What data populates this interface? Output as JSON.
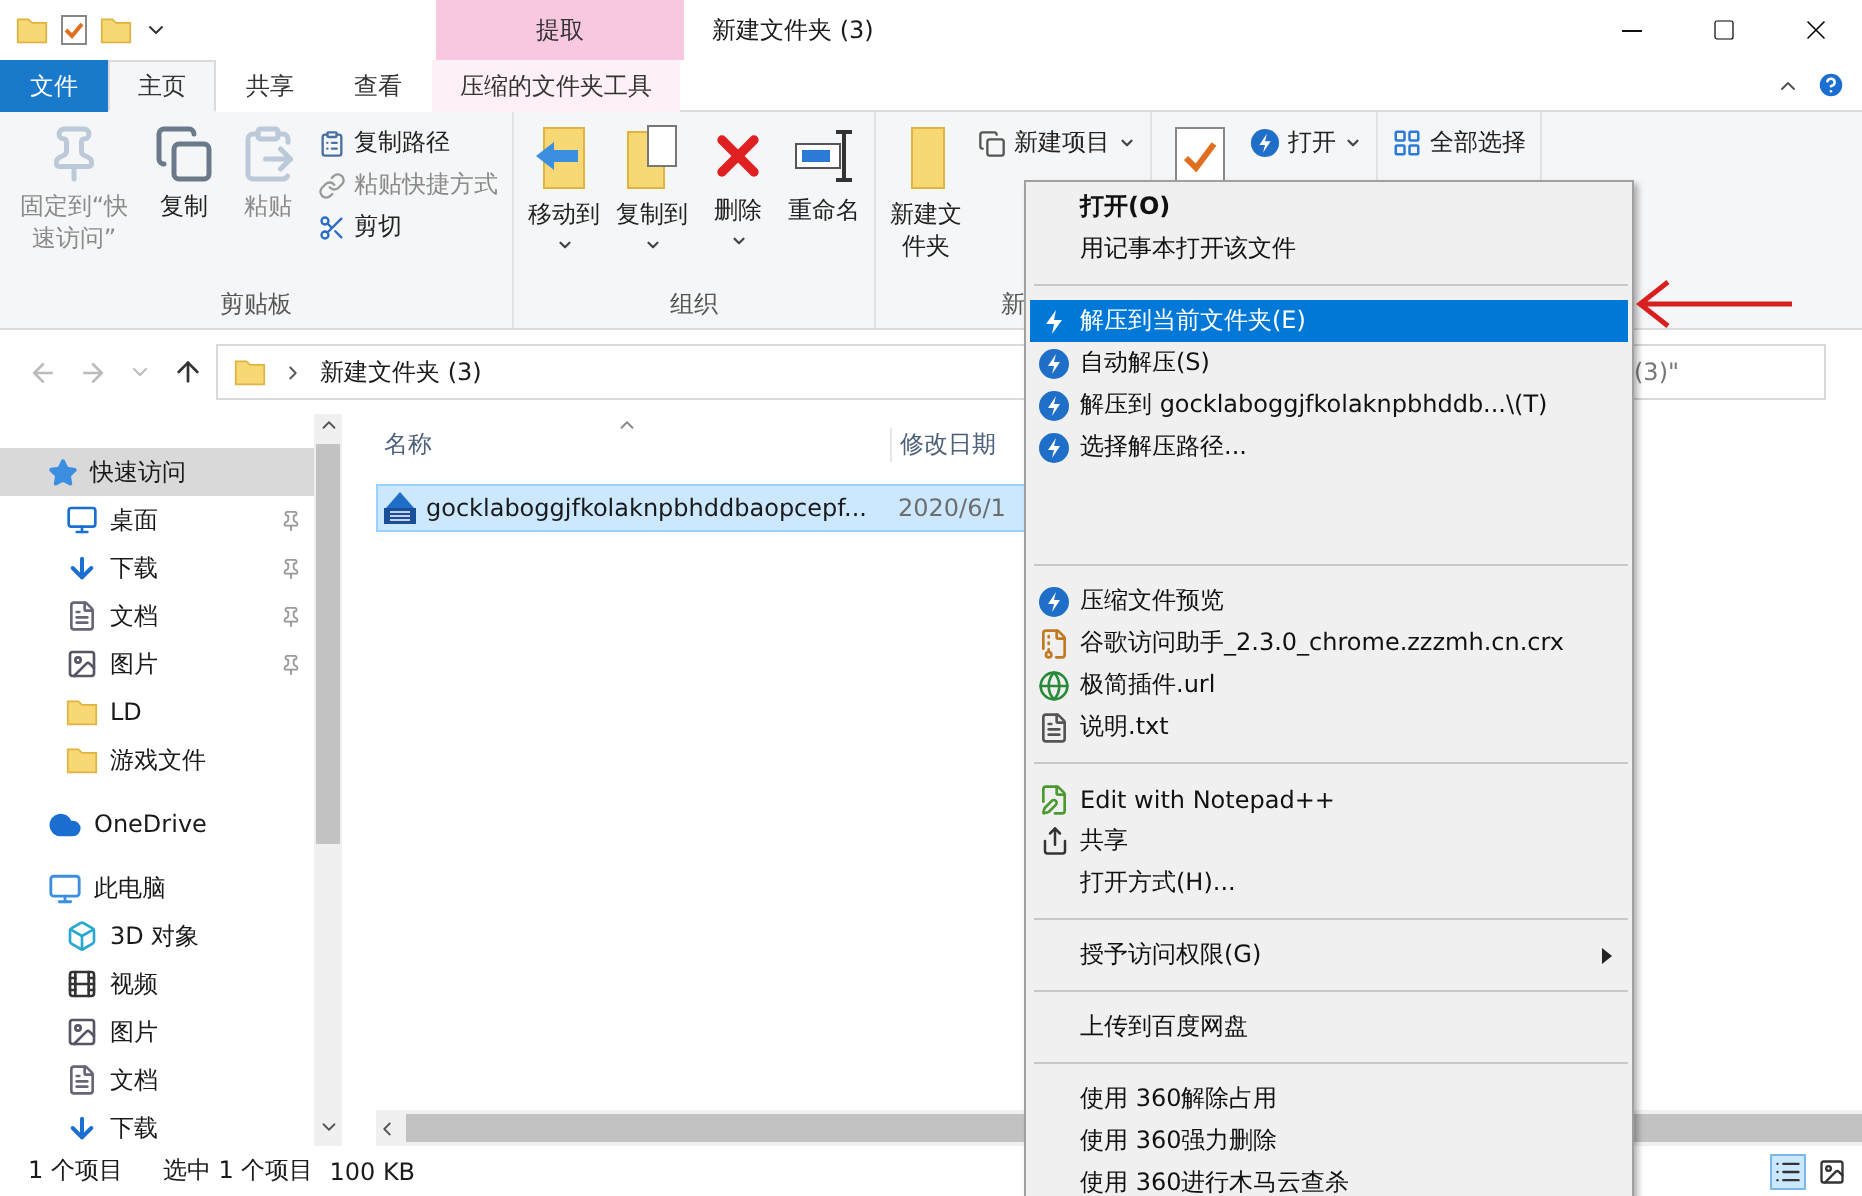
{
  "title_bar": {
    "title": "新建文件夹 (3)",
    "context_tab": "提取"
  },
  "ribbon_tabs": [
    {
      "label": "文件",
      "kind": "file",
      "selected": false
    },
    {
      "label": "主页",
      "kind": "tab",
      "selected": true
    },
    {
      "label": "共享",
      "kind": "tab",
      "selected": false
    },
    {
      "label": "查看",
      "kind": "tab",
      "selected": false
    },
    {
      "label": "压缩的文件夹工具",
      "kind": "context",
      "selected": false
    }
  ],
  "ribbon_groups": [
    {
      "label": "剪贴板",
      "items": [
        {
          "kind": "large",
          "label": "固定到“快速访问”",
          "disabled": true,
          "dropdown": false
        },
        {
          "kind": "large",
          "label": "复制",
          "disabled": false,
          "dropdown": false
        },
        {
          "kind": "large",
          "label": "粘贴",
          "disabled": true,
          "dropdown": false
        },
        {
          "kind": "small",
          "label": "复制路径",
          "disabled": false,
          "dropdown": false
        },
        {
          "kind": "small",
          "label": "粘贴快捷方式",
          "disabled": true,
          "dropdown": false
        },
        {
          "kind": "small",
          "label": "剪切",
          "disabled": false,
          "dropdown": false
        }
      ]
    },
    {
      "label": "组织",
      "items": [
        {
          "kind": "large",
          "label": "移动到",
          "disabled": false,
          "dropdown": true
        },
        {
          "kind": "large",
          "label": "复制到",
          "disabled": false,
          "dropdown": true
        },
        {
          "kind": "large",
          "label": "删除",
          "disabled": false,
          "dropdown": true
        },
        {
          "kind": "large",
          "label": "重命名",
          "disabled": false,
          "dropdown": false
        }
      ]
    },
    {
      "label": "新",
      "items": [
        {
          "kind": "large",
          "label": "新建文件夹",
          "disabled": false,
          "dropdown": false
        },
        {
          "kind": "small",
          "label": "新建项目",
          "disabled": false,
          "dropdown": true
        }
      ]
    },
    {
      "items": [
        {
          "kind": "large",
          "disabled": false
        },
        {
          "kind": "small",
          "label": "打开",
          "disabled": false,
          "dropdown": true
        }
      ]
    },
    {
      "items": [
        {
          "kind": "small",
          "label": "全部选择",
          "disabled": false,
          "dropdown": false
        }
      ]
    }
  ],
  "address": {
    "path": "新建文件夹 (3)"
  },
  "search": {
    "placeholder": "(3)\""
  },
  "navigation": [
    {
      "label": "快速访问",
      "selected": true,
      "pinned": false,
      "children": [
        {
          "label": "桌面",
          "selected": false,
          "pinned": true
        },
        {
          "label": "下载",
          "selected": false,
          "pinned": true
        },
        {
          "label": "文档",
          "selected": false,
          "pinned": true
        },
        {
          "label": "图片",
          "selected": false,
          "pinned": true
        },
        {
          "label": "LD",
          "selected": false,
          "pinned": false
        },
        {
          "label": "游戏文件",
          "selected": false,
          "pinned": false
        }
      ]
    },
    {
      "label": "OneDrive",
      "selected": false,
      "pinned": false
    },
    {
      "label": "此电脑",
      "selected": false,
      "pinned": false,
      "children": [
        {
          "label": "3D 对象",
          "selected": false,
          "pinned": false
        },
        {
          "label": "视频",
          "selected": false,
          "pinned": false
        },
        {
          "label": "图片",
          "selected": false,
          "pinned": false
        },
        {
          "label": "文档",
          "selected": false,
          "pinned": false
        },
        {
          "label": "下载",
          "selected": false,
          "pinned": false
        }
      ]
    }
  ],
  "file_list": {
    "columns": [
      "名称",
      "修改日期"
    ],
    "rows": [
      {
        "name": "gocklaboggjfkolaknpbhddbaopcepf...",
        "date": "2020/6/1",
        "selected": true
      }
    ]
  },
  "status_bar": {
    "count": "1 个项目",
    "selection": "选中 1 个项目",
    "size": "100 KB",
    "views": [
      {
        "kind": "details",
        "selected": true
      },
      {
        "kind": "thumbnails",
        "selected": false
      }
    ]
  },
  "context_menu": {
    "sections": [
      [
        {
          "kind": "plain",
          "label": "打开(O)",
          "default": true,
          "selected": false,
          "submenu": false
        },
        {
          "kind": "plain",
          "label": "用记事本打开该文件",
          "default": false,
          "selected": false,
          "submenu": false
        }
      ],
      [
        {
          "kind": "extract",
          "label": "解压到当前文件夹(E)",
          "default": false,
          "selected": true,
          "submenu": false
        },
        {
          "kind": "extract",
          "label": "自动解压(S)",
          "default": false,
          "selected": false,
          "submenu": false
        },
        {
          "kind": "extract",
          "label": "解压到 gocklaboggjfkolaknpbhddb...\\(T)",
          "default": false,
          "selected": false,
          "submenu": false
        },
        {
          "kind": "extract",
          "label": "选择解压路径...",
          "default": false,
          "selected": false,
          "submenu": false
        }
      ],
      [
        {
          "kind": "preview",
          "label": "压缩文件预览",
          "default": false,
          "selected": false,
          "submenu": false
        },
        {
          "kind": "crx",
          "label": "谷歌访问助手_2.3.0_chrome.zzzmh.cn.crx",
          "default": false,
          "selected": false,
          "submenu": false
        },
        {
          "kind": "url",
          "label": "极简插件.url",
          "default": false,
          "selected": false,
          "submenu": false
        },
        {
          "kind": "txt",
          "label": "说明.txt",
          "default": false,
          "selected": false,
          "submenu": false
        }
      ],
      [
        {
          "kind": "notepad",
          "label": "Edit with Notepad++",
          "default": false,
          "selected": false,
          "submenu": false
        },
        {
          "kind": "share",
          "label": "共享",
          "default": false,
          "selected": false,
          "submenu": false
        },
        {
          "kind": "plain",
          "label": "打开方式(H)...",
          "default": false,
          "selected": false,
          "submenu": false
        }
      ],
      [
        {
          "kind": "plain",
          "label": "授予访问权限(G)",
          "default": false,
          "selected": false,
          "submenu": true
        }
      ],
      [
        {
          "kind": "plain",
          "label": "上传到百度网盘",
          "default": false,
          "selected": false,
          "submenu": false
        }
      ],
      [
        {
          "kind": "plain",
          "label": "使用 360解除占用",
          "default": false,
          "selected": false,
          "submenu": false
        },
        {
          "kind": "plain",
          "label": "使用 360强力删除",
          "default": false,
          "selected": false,
          "submenu": false
        },
        {
          "kind": "plain",
          "label": "使用 360进行木马云查杀",
          "default": false,
          "selected": false,
          "submenu": false
        }
      ]
    ]
  }
}
